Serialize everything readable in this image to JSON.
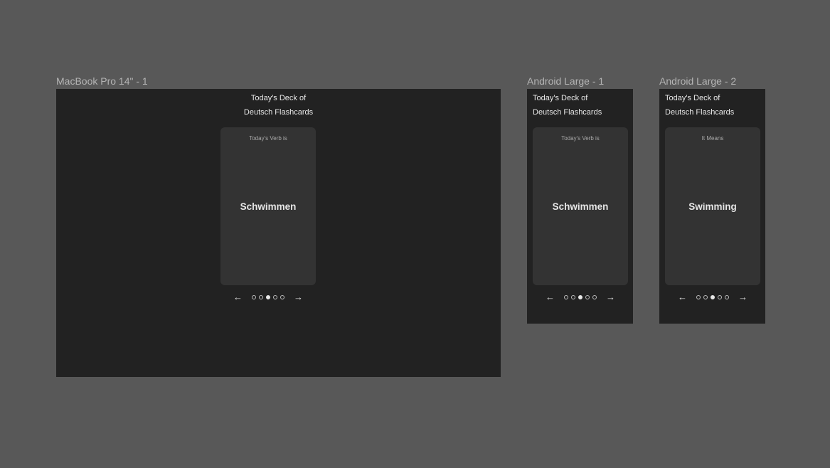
{
  "frames": [
    {
      "label": "MacBook Pro 14\" - 1",
      "deck_title_line1": "Today's Deck of",
      "deck_title_line2": "Deutsch Flashcards",
      "card_caption": "Today's Verb is",
      "card_word": "Schwimmen",
      "pager": {
        "prev_icon": "←",
        "next_icon": "→",
        "total": 5,
        "active_index": 2
      }
    },
    {
      "label": "Android Large - 1",
      "deck_title_line1": "Today's Deck of",
      "deck_title_line2": "Deutsch Flashcards",
      "card_caption": "Today's Verb is",
      "card_word": "Schwimmen",
      "pager": {
        "prev_icon": "←",
        "next_icon": "→",
        "total": 5,
        "active_index": 2
      }
    },
    {
      "label": "Android Large - 2",
      "deck_title_line1": "Today's Deck of",
      "deck_title_line2": "Deutsch Flashcards",
      "card_caption": "It Means",
      "card_word": "Swimming",
      "pager": {
        "prev_icon": "←",
        "next_icon": "→",
        "total": 5,
        "active_index": 2
      }
    }
  ],
  "colors": {
    "canvas": "#585858",
    "frame": "#222222",
    "card": "#333333",
    "text": "#e8e8e8",
    "label": "#b4b4b4"
  }
}
